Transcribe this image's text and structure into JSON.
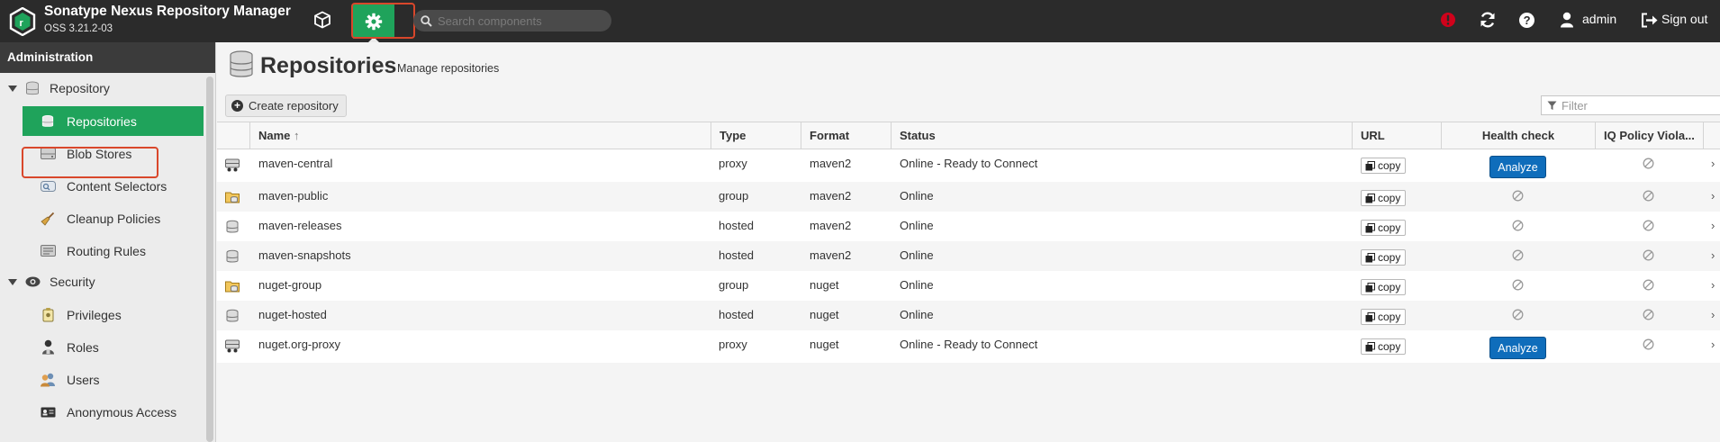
{
  "app": {
    "title": "Sonatype Nexus Repository Manager",
    "version": "OSS 3.21.2-03"
  },
  "header": {
    "search_placeholder": "Search components",
    "user_label": "admin",
    "signout_label": "Sign out",
    "alert_color": "#d0021b",
    "active_color": "#1fa35b"
  },
  "sidebar": {
    "title": "Administration",
    "groups": [
      {
        "label": "Repository",
        "items": [
          "Repositories",
          "Blob Stores",
          "Content Selectors",
          "Cleanup Policies",
          "Routing Rules"
        ]
      },
      {
        "label": "Security",
        "items": [
          "Privileges",
          "Roles",
          "Users",
          "Anonymous Access"
        ]
      }
    ]
  },
  "main": {
    "title": "Repositories",
    "subtitle": "Manage repositories",
    "create_label": "Create repository",
    "filter_placeholder": "Filter",
    "columns": [
      "Name",
      "Type",
      "Format",
      "Status",
      "URL",
      "Health check",
      "IQ Policy Viola..."
    ],
    "sort_indicator": "↑",
    "copy_label": "copy",
    "analyze_label": "Analyze",
    "rows": [
      {
        "name": "maven-central",
        "type": "proxy",
        "format": "maven2",
        "status": "Online - Ready to Connect",
        "health": "analyze",
        "icon": "proxy-repo-icon"
      },
      {
        "name": "maven-public",
        "type": "group",
        "format": "maven2",
        "status": "Online",
        "health": "na",
        "icon": "group-repo-icon"
      },
      {
        "name": "maven-releases",
        "type": "hosted",
        "format": "maven2",
        "status": "Online",
        "health": "na",
        "icon": "hosted-repo-icon"
      },
      {
        "name": "maven-snapshots",
        "type": "hosted",
        "format": "maven2",
        "status": "Online",
        "health": "na",
        "icon": "hosted-repo-icon"
      },
      {
        "name": "nuget-group",
        "type": "group",
        "format": "nuget",
        "status": "Online",
        "health": "na",
        "icon": "group-repo-icon"
      },
      {
        "name": "nuget-hosted",
        "type": "hosted",
        "format": "nuget",
        "status": "Online",
        "health": "na",
        "icon": "hosted-repo-icon"
      },
      {
        "name": "nuget.org-proxy",
        "type": "proxy",
        "format": "nuget",
        "status": "Online - Ready to Connect",
        "health": "analyze",
        "icon": "proxy-repo-icon"
      }
    ]
  }
}
